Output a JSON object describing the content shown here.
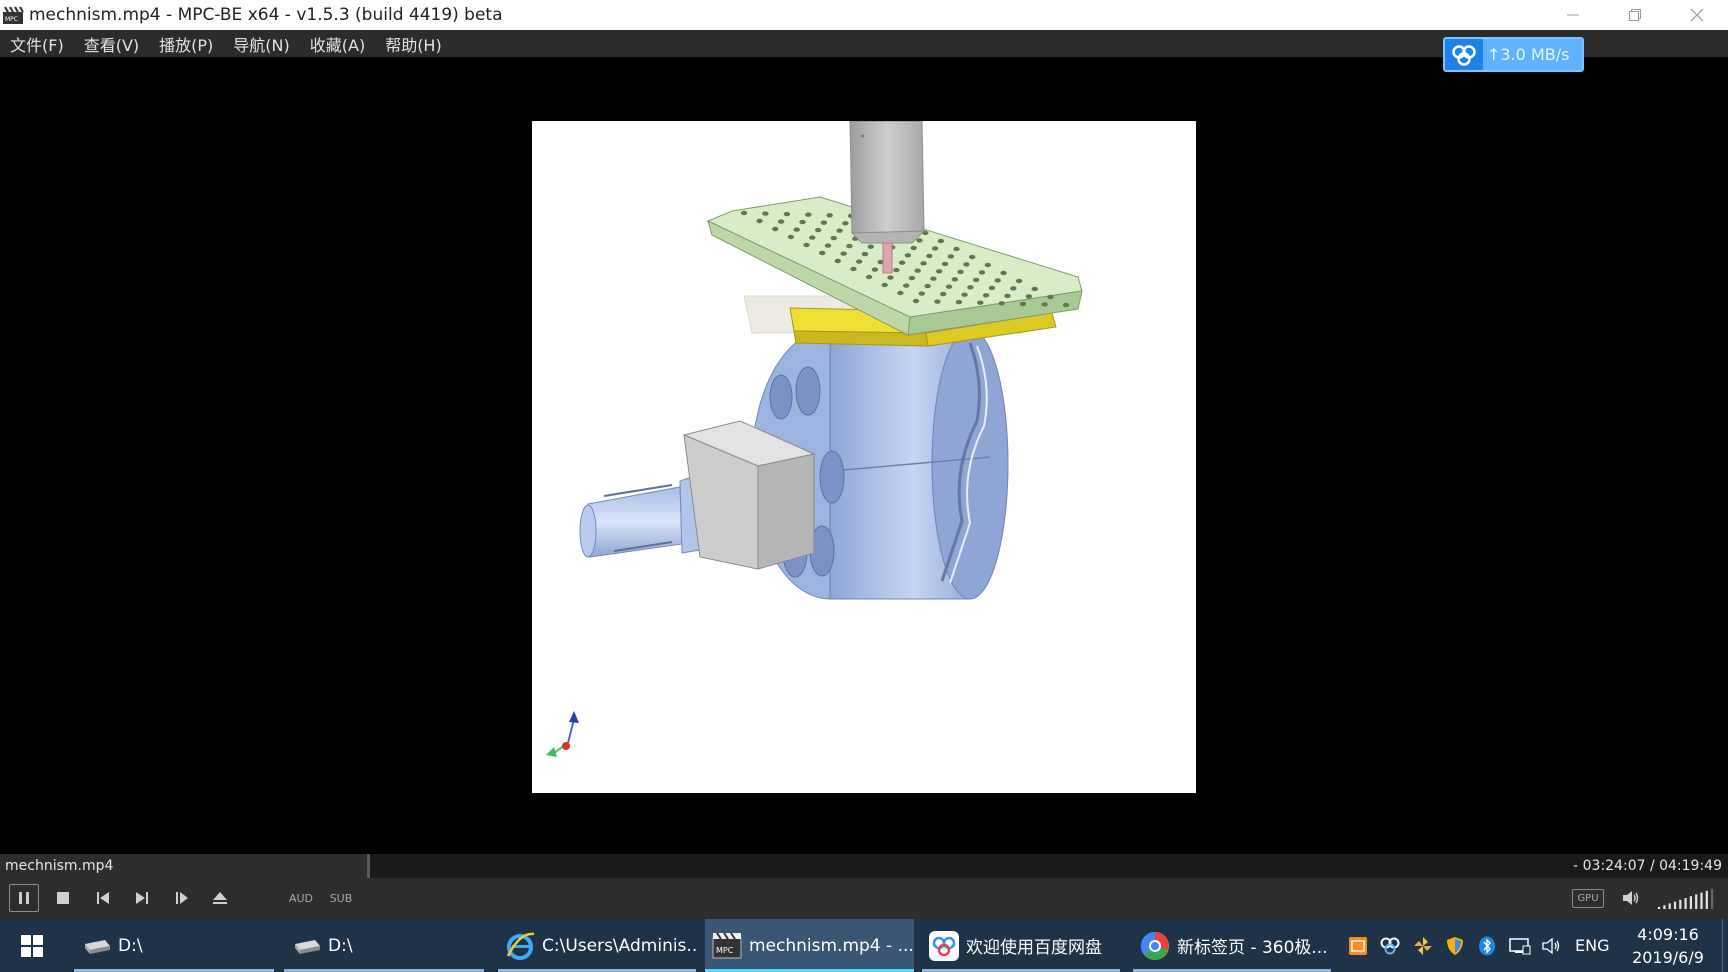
{
  "window": {
    "title": "mechnism.mp4 - MPC-BE x64 - v1.5.3 (build 4419) beta"
  },
  "menu": {
    "items": [
      "文件(F)",
      "查看(V)",
      "播放(P)",
      "导航(N)",
      "收藏(A)",
      "帮助(H)"
    ]
  },
  "netspeed": {
    "value": "↑3.0 MB/s"
  },
  "status": {
    "filename": "mechnism.mp4",
    "time": "- 03:24:07 / 04:19:49"
  },
  "controls": {
    "aud_label": "AUD",
    "sub_label": "SUB",
    "gpu_label": "GPU",
    "volume_level": 0.95
  },
  "taskbar": {
    "tasks": [
      {
        "label": "D:\\",
        "icon": "drive-icon"
      },
      {
        "label": "D:\\",
        "icon": "drive-icon"
      },
      {
        "label": "C:\\Users\\Adminis...",
        "icon": "ie-icon"
      },
      {
        "label": "mechnism.mp4 - ...",
        "icon": "mpc-icon"
      },
      {
        "label": "欢迎使用百度网盘",
        "icon": "baidu-netdisk-icon"
      },
      {
        "label": "新标签页 - 360极...",
        "icon": "360-browser-icon"
      }
    ],
    "language": "ENG",
    "time": "4:09:16",
    "date": "2019/6/9"
  },
  "colors": {
    "menubar": "#2b2b2b",
    "taskbar": "#1e3248",
    "accent": "#2f93f2"
  }
}
